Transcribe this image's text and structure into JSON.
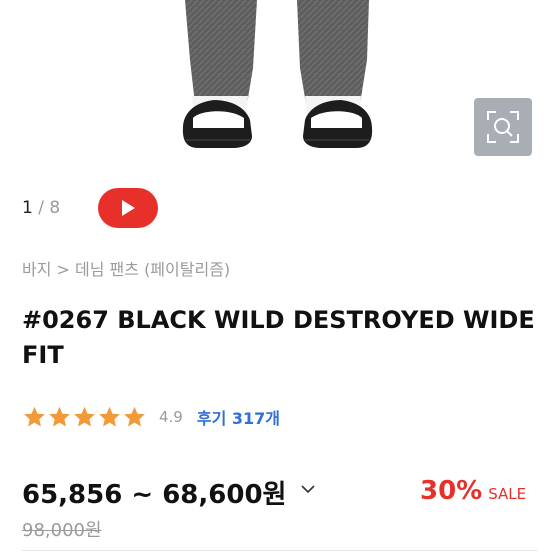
{
  "gallery": {
    "current": "1",
    "separator": "/",
    "total": "8",
    "zoom_icon": "zoom-search-icon",
    "video_icon": "play-icon"
  },
  "breadcrumb": "바지 > 데님 팬츠 (페이탈리즘)",
  "product": {
    "title": "#0267 BLACK WILD DESTROYED WIDE FIT",
    "rating": 4.9,
    "rating_text": "4.9",
    "reviews": "후기 317개",
    "price_range": "65,856 ~ 68,600원",
    "discount": "30%",
    "sale_label": "SALE",
    "original_price": "98,000원"
  },
  "colors": {
    "accent_red": "#e8302a",
    "star": "#f29a3a",
    "link_blue": "#2f6fd6"
  }
}
